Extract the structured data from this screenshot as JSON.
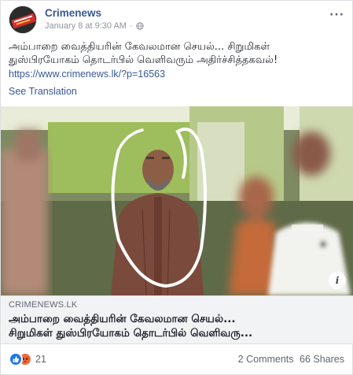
{
  "post": {
    "page_name": "Crimenews",
    "timestamp": "January 8 at 9:30 AM",
    "timestamp_separator": "·",
    "more_label": "···",
    "text_line1": "அம்பாறை வைத்தியரின் கேவலமான செயல்... சிறுமிகள்",
    "text_line2": "துஸ்பிரயோகம் தொடர்பில் வெளிவரும் அதிர்ச்சித்தகவல்!",
    "link": "https://www.crimenews.lk/?p=16563",
    "see_translation": "See Translation"
  },
  "photo": {
    "info_label": "i"
  },
  "link_card": {
    "domain": "CRIMENEWS.LK",
    "title_line1": "அம்பாறை வைத்தியரின் கேவலமான செயல்...",
    "title_line2": "சிறுமிகள் துஸ்பிரயோகம் தொடர்பில் வெளிவரு..."
  },
  "footer": {
    "reaction_count": "21",
    "comments": "2 Comments",
    "shares": "66 Shares"
  },
  "icons": {
    "globe": "globe-icon",
    "like": "like-reaction-icon",
    "angry": "angry-reaction-icon",
    "info": "info-icon"
  },
  "colors": {
    "link_blue": "#385898",
    "like_blue": "#1877f2",
    "angry_orange": "#f0683c",
    "card_bg": "#f2f3f5"
  }
}
